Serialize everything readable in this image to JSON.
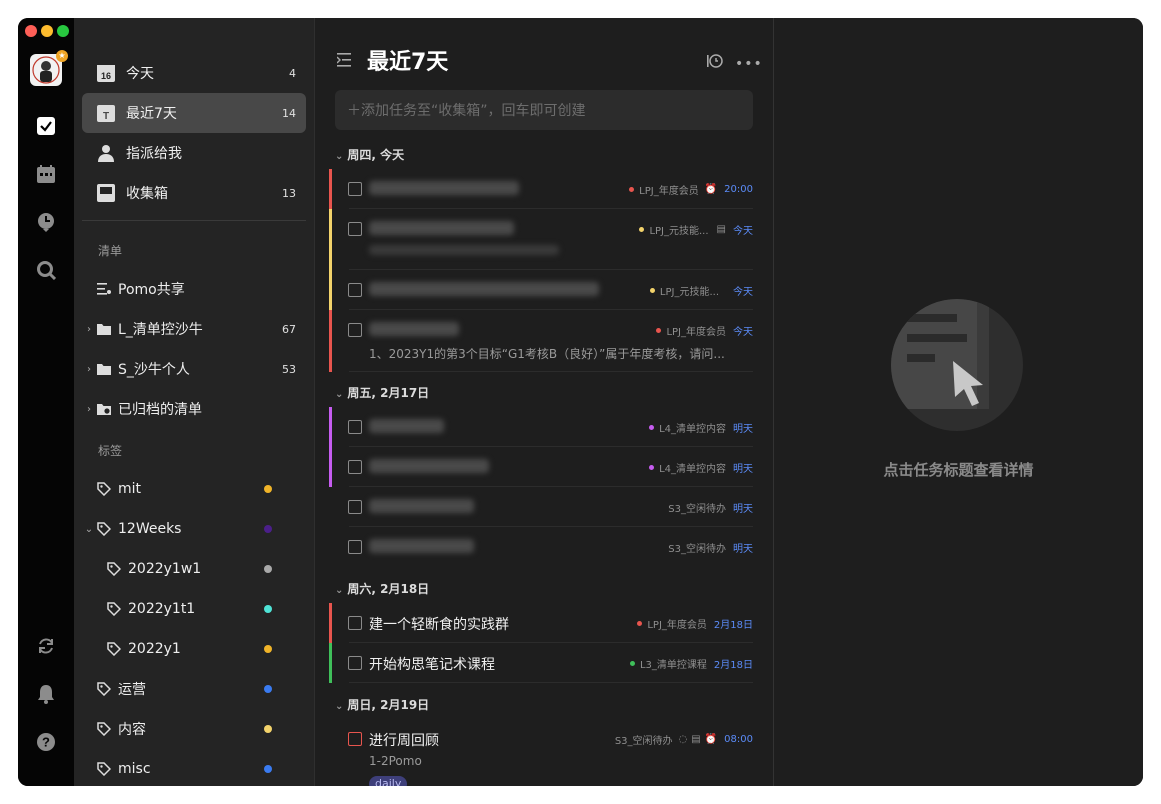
{
  "header": {
    "title": "最近7天"
  },
  "add_task": {
    "placeholder": "＋添加任务至“收集箱”，回车即可创建"
  },
  "nav": [
    {
      "label": "今天",
      "count": "4",
      "icon": "calendar-16-icon",
      "day": "16"
    },
    {
      "label": "最近7天",
      "count": "14",
      "icon": "calendar-7-icon",
      "active": true
    },
    {
      "label": "指派给我",
      "count": "",
      "icon": "assign-user-icon"
    },
    {
      "label": "收集箱",
      "count": "13",
      "icon": "inbox-icon"
    }
  ],
  "lists_title": "清单",
  "lists": [
    {
      "label": "Pomo共享",
      "count": "",
      "icon": "shared-list-icon",
      "chevron": false
    },
    {
      "label": "L_清单控沙牛",
      "count": "67",
      "icon": "folder-icon",
      "chevron": true
    },
    {
      "label": "S_沙牛个人",
      "count": "53",
      "icon": "folder-icon",
      "chevron": true
    },
    {
      "label": "已归档的清单",
      "count": "",
      "icon": "archive-folder-icon",
      "chevron": true
    }
  ],
  "tags_title": "标签",
  "tags": [
    {
      "label": "mit",
      "color": "#f0b429",
      "indent": 0
    },
    {
      "label": "12Weeks",
      "color": "#4b1f8a",
      "indent": 0,
      "chevron": "down"
    },
    {
      "label": "2022y1w1",
      "color": "#a9a9a9",
      "indent": 1
    },
    {
      "label": "2022y1t1",
      "color": "#4fe3d6",
      "indent": 1
    },
    {
      "label": "2022y1",
      "color": "#f0b429",
      "indent": 1
    },
    {
      "label": "运营",
      "color": "#3a7bf0",
      "indent": 0
    },
    {
      "label": "内容",
      "color": "#f3d36b",
      "indent": 0
    },
    {
      "label": "misc",
      "color": "#3a7bf0",
      "indent": 0
    }
  ],
  "groups": [
    {
      "label": "周四, 今天",
      "tasks": [
        {
          "title": "",
          "list": "LPJ_年度会员",
          "list_color": "#e8554e",
          "bar": "#e8554e",
          "date": "20:00",
          "alarm": true
        },
        {
          "title": "",
          "list": "LPJ_元技能...",
          "list_color": "#f3d36b",
          "bar": "#f3d36b",
          "date": "今天",
          "note": true
        },
        {
          "title": "",
          "list": "LPJ_元技能...",
          "list_color": "#f3d36b",
          "bar": "#f3d36b",
          "date": "今天"
        },
        {
          "title": "",
          "list": "LPJ_年度会员",
          "list_color": "#e8554e",
          "bar": "#e8554e",
          "date": "今天",
          "sub": "1、2023Y1的第3个目标“G1考核B（良好）”属于年度考核，请问..."
        }
      ]
    },
    {
      "label": "周五, 2月17日",
      "tasks": [
        {
          "title": "",
          "list": "L4_清单控内容",
          "list_color": "#c65cf0",
          "bar": "#c65cf0",
          "date": "明天"
        },
        {
          "title": "",
          "list": "L4_清单控内容",
          "list_color": "#c65cf0",
          "bar": "#c65cf0",
          "date": "明天"
        },
        {
          "title": "",
          "list": "S3_空闲待办",
          "list_color": "",
          "bar": "",
          "date": "明天"
        },
        {
          "title": "",
          "list": "S3_空闲待办",
          "list_color": "",
          "bar": "",
          "date": "明天"
        }
      ]
    },
    {
      "label": "周六, 2月18日",
      "tasks": [
        {
          "title": "建一个轻断食的实践群",
          "list": "LPJ_年度会员",
          "list_color": "#e8554e",
          "bar": "#e8554e",
          "date": "2月18日"
        },
        {
          "title": "开始构思笔记术课程",
          "list": "L3_清单控课程",
          "list_color": "#3fbf5a",
          "bar": "#3fbf5a",
          "date": "2月18日"
        }
      ]
    },
    {
      "label": "周日, 2月19日",
      "tasks": [
        {
          "title": "进行周回顾",
          "list": "S3_空闲待办",
          "list_color": "",
          "bar": "",
          "date": "08:00",
          "sub": "1-2Pomo",
          "tag": "daily",
          "checkbox_color": "#e8554e"
        }
      ]
    }
  ],
  "detail": {
    "hint": "点击任务标题查看详情"
  }
}
